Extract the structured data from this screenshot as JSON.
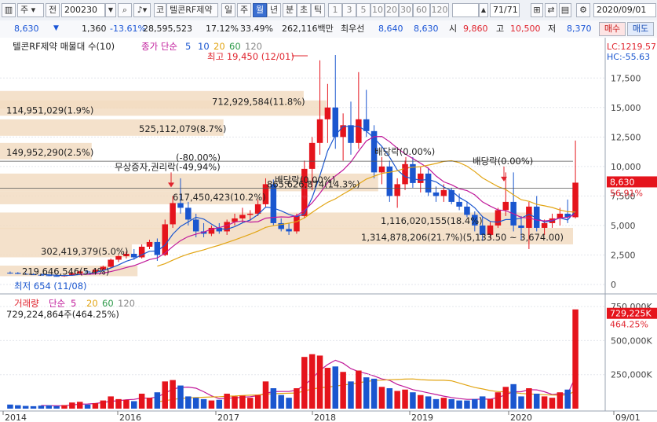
{
  "toolbar": {
    "market": "주",
    "basis": "전",
    "code": "200230",
    "stock_tag": "코",
    "stock_name": "텔콘RF제약",
    "periods": [
      "일",
      "주",
      "월",
      "년",
      "분",
      "초",
      "틱"
    ],
    "selected_period": "월",
    "intervals": [
      "1",
      "3",
      "5",
      "10",
      "20",
      "30",
      "60",
      "120"
    ],
    "page": "71",
    "page_total": "/71",
    "date": "2020/09/01"
  },
  "quote": {
    "price": "8,630",
    "change": "1,360",
    "change_pct": "-13.61%",
    "volume": "28,595,523",
    "vol_ratio_pct": "17.12%",
    "turnover_pct": "33.49%",
    "amount": "262,116백만",
    "bid_label": "최우선",
    "bid_ask": [
      "8,640",
      "8,630"
    ],
    "open_label": "시",
    "open": "9,860",
    "high_label": "고",
    "high": "10,500",
    "low_label": "저",
    "low": "8,370",
    "buy_label": "매수",
    "sell_label": "매도"
  },
  "price_panel": {
    "title": "텔콘RF제약 매물대 수(10)",
    "ma_label": "종가 단순",
    "ma_periods": [
      "5",
      "10",
      "20",
      "60",
      "120"
    ],
    "lc": "LC:1219.57",
    "hc": "HC:-55.63",
    "max_note": "최고 19,450 (12/01)",
    "min_note": "최저 654 (11/08)",
    "current_price": "8,630",
    "current_pct": "56.91%",
    "annotations": [
      {
        "label": "무상증자,권리락(-49,94%)",
        "sub": "(-80.00%)"
      },
      {
        "label": "배당락(0.00%)"
      },
      {
        "label": "배당락(0.00%)"
      },
      {
        "label": "배당락(0.00%)"
      }
    ],
    "profiles": [
      {
        "label": "114,951,029(1.9%)"
      },
      {
        "label": "149,952,290(2.5%)"
      },
      {
        "label": "712,929,584(11.8%)"
      },
      {
        "label": "525,112,079(8.7%)"
      },
      {
        "label": "865,626,874(14.3%)"
      },
      {
        "label": "617,450,423(10.2%)"
      },
      {
        "label": "1,116,020,155(18.4%)"
      },
      {
        "label": "1,314,878,206(21.7%)(5,133.50 ~ 3,674.00)"
      },
      {
        "label": "302,419,379(5.0%)"
      },
      {
        "label": "219,646,546(5.4%)"
      }
    ]
  },
  "volume_panel": {
    "title": "거래량",
    "ma_label": "단순",
    "ma_periods": [
      "5",
      "20",
      "60",
      "120"
    ],
    "current_text": "729,224,864주(464.25%)",
    "last_value": "729,225K",
    "last_pct": "464.25%"
  },
  "x_axis": [
    "2014",
    "2016",
    "2017",
    "2018",
    "2019",
    "2020",
    "09/01"
  ],
  "colors": {
    "up": "#e5141c",
    "down": "#1a56cf",
    "ma5": "#1a56cf",
    "ma10": "#c0199a",
    "ma20": "#e2a514",
    "profile": "#f2dcc2"
  },
  "chart_data": {
    "type": "candlestick",
    "price_ylim": [
      0,
      19450
    ],
    "price_yticks": [
      0,
      2500,
      5000,
      7500,
      10000,
      12500,
      15000,
      17500
    ],
    "volume_yticks": [
      250000,
      500000,
      750000
    ],
    "volume_unit": "K",
    "candles": [
      {
        "o": 1000,
        "h": 1100,
        "l": 900,
        "c": 980,
        "v": 30000
      },
      {
        "o": 980,
        "h": 1050,
        "l": 880,
        "c": 900,
        "v": 25000
      },
      {
        "o": 900,
        "h": 1000,
        "l": 820,
        "c": 860,
        "v": 20000
      },
      {
        "o": 860,
        "h": 950,
        "l": 800,
        "c": 820,
        "v": 18000
      },
      {
        "o": 820,
        "h": 900,
        "l": 760,
        "c": 780,
        "v": 22000
      },
      {
        "o": 780,
        "h": 880,
        "l": 700,
        "c": 720,
        "v": 24000
      },
      {
        "o": 720,
        "h": 820,
        "l": 680,
        "c": 700,
        "v": 19000
      },
      {
        "o": 700,
        "h": 800,
        "l": 654,
        "c": 760,
        "v": 26000
      },
      {
        "o": 760,
        "h": 1000,
        "l": 740,
        "c": 950,
        "v": 45000
      },
      {
        "o": 950,
        "h": 1150,
        "l": 900,
        "c": 1100,
        "v": 50000
      },
      {
        "o": 1100,
        "h": 1200,
        "l": 1000,
        "c": 1050,
        "v": 30000
      },
      {
        "o": 1050,
        "h": 1300,
        "l": 1000,
        "c": 1250,
        "v": 40000
      },
      {
        "o": 1250,
        "h": 1600,
        "l": 1200,
        "c": 1500,
        "v": 60000
      },
      {
        "o": 1500,
        "h": 2200,
        "l": 1400,
        "c": 2100,
        "v": 90000
      },
      {
        "o": 2100,
        "h": 2500,
        "l": 1900,
        "c": 2400,
        "v": 70000
      },
      {
        "o": 2400,
        "h": 2800,
        "l": 2200,
        "c": 2600,
        "v": 65000
      },
      {
        "o": 2600,
        "h": 3000,
        "l": 2100,
        "c": 2300,
        "v": 55000
      },
      {
        "o": 2300,
        "h": 3400,
        "l": 2200,
        "c": 3200,
        "v": 110000
      },
      {
        "o": 3200,
        "h": 3800,
        "l": 3000,
        "c": 3600,
        "v": 80000
      },
      {
        "o": 3600,
        "h": 3900,
        "l": 2000,
        "c": 2500,
        "v": 120000
      },
      {
        "o": 2500,
        "h": 5500,
        "l": 2400,
        "c": 5100,
        "v": 200000
      },
      {
        "o": 5100,
        "h": 7500,
        "l": 4800,
        "c": 6900,
        "v": 210000
      },
      {
        "o": 6900,
        "h": 9000,
        "l": 6000,
        "c": 6500,
        "v": 170000
      },
      {
        "o": 6500,
        "h": 7000,
        "l": 5000,
        "c": 5500,
        "v": 90000
      },
      {
        "o": 5500,
        "h": 6000,
        "l": 4000,
        "c": 4500,
        "v": 80000
      },
      {
        "o": 4500,
        "h": 5200,
        "l": 4000,
        "c": 4300,
        "v": 70000
      },
      {
        "o": 4300,
        "h": 5000,
        "l": 4100,
        "c": 4800,
        "v": 60000
      },
      {
        "o": 4800,
        "h": 5200,
        "l": 4300,
        "c": 4500,
        "v": 65000
      },
      {
        "o": 4500,
        "h": 5500,
        "l": 4200,
        "c": 5300,
        "v": 110000
      },
      {
        "o": 5300,
        "h": 6000,
        "l": 5000,
        "c": 5600,
        "v": 90000
      },
      {
        "o": 5600,
        "h": 6500,
        "l": 5200,
        "c": 5900,
        "v": 95000
      },
      {
        "o": 5900,
        "h": 6300,
        "l": 5400,
        "c": 6000,
        "v": 80000
      },
      {
        "o": 6000,
        "h": 7200,
        "l": 5800,
        "c": 6800,
        "v": 100000
      },
      {
        "o": 6800,
        "h": 9000,
        "l": 6500,
        "c": 8500,
        "v": 200000
      },
      {
        "o": 8500,
        "h": 8900,
        "l": 5000,
        "c": 5200,
        "v": 150000
      },
      {
        "o": 5200,
        "h": 5600,
        "l": 4500,
        "c": 4700,
        "v": 100000
      },
      {
        "o": 4700,
        "h": 5200,
        "l": 4200,
        "c": 4500,
        "v": 80000
      },
      {
        "o": 4500,
        "h": 6000,
        "l": 4300,
        "c": 5800,
        "v": 150000
      },
      {
        "o": 5800,
        "h": 10500,
        "l": 5600,
        "c": 9800,
        "v": 380000
      },
      {
        "o": 9800,
        "h": 12500,
        "l": 8000,
        "c": 12000,
        "v": 400000
      },
      {
        "o": 12000,
        "h": 19000,
        "l": 11000,
        "c": 14000,
        "v": 390000
      },
      {
        "o": 14000,
        "h": 17000,
        "l": 12000,
        "c": 15000,
        "v": 300000
      },
      {
        "o": 15000,
        "h": 19450,
        "l": 11500,
        "c": 12500,
        "v": 310000
      },
      {
        "o": 12500,
        "h": 14500,
        "l": 10500,
        "c": 13500,
        "v": 270000
      },
      {
        "o": 13500,
        "h": 15500,
        "l": 11000,
        "c": 12000,
        "v": 200000
      },
      {
        "o": 12000,
        "h": 18000,
        "l": 11500,
        "c": 14000,
        "v": 280000
      },
      {
        "o": 14000,
        "h": 16500,
        "l": 12500,
        "c": 13000,
        "v": 230000
      },
      {
        "o": 13000,
        "h": 13500,
        "l": 9000,
        "c": 9500,
        "v": 220000
      },
      {
        "o": 9500,
        "h": 10800,
        "l": 8500,
        "c": 10000,
        "v": 160000
      },
      {
        "o": 10000,
        "h": 10500,
        "l": 7000,
        "c": 7500,
        "v": 150000
      },
      {
        "o": 7500,
        "h": 9000,
        "l": 6500,
        "c": 8500,
        "v": 130000
      },
      {
        "o": 8500,
        "h": 10500,
        "l": 8000,
        "c": 10200,
        "v": 140000
      },
      {
        "o": 10200,
        "h": 10800,
        "l": 8200,
        "c": 8600,
        "v": 120000
      },
      {
        "o": 8600,
        "h": 10000,
        "l": 7800,
        "c": 9400,
        "v": 100000
      },
      {
        "o": 9400,
        "h": 9900,
        "l": 7500,
        "c": 7800,
        "v": 90000
      },
      {
        "o": 7800,
        "h": 8300,
        "l": 7000,
        "c": 7500,
        "v": 70000
      },
      {
        "o": 7500,
        "h": 8500,
        "l": 7000,
        "c": 8000,
        "v": 80000
      },
      {
        "o": 8000,
        "h": 8200,
        "l": 6800,
        "c": 7000,
        "v": 70000
      },
      {
        "o": 7000,
        "h": 7700,
        "l": 6300,
        "c": 6600,
        "v": 60000
      },
      {
        "o": 6600,
        "h": 7000,
        "l": 5700,
        "c": 5900,
        "v": 60000
      },
      {
        "o": 5900,
        "h": 6200,
        "l": 4500,
        "c": 5000,
        "v": 70000
      },
      {
        "o": 5000,
        "h": 5700,
        "l": 3700,
        "c": 4200,
        "v": 90000
      },
      {
        "o": 4200,
        "h": 5300,
        "l": 3900,
        "c": 5000,
        "v": 70000
      },
      {
        "o": 5000,
        "h": 6500,
        "l": 4800,
        "c": 6300,
        "v": 120000
      },
      {
        "o": 6300,
        "h": 9500,
        "l": 5800,
        "c": 7000,
        "v": 160000
      },
      {
        "o": 7000,
        "h": 9500,
        "l": 4500,
        "c": 5000,
        "v": 180000
      },
      {
        "o": 5000,
        "h": 5800,
        "l": 3800,
        "c": 4800,
        "v": 90000
      },
      {
        "o": 4800,
        "h": 7000,
        "l": 3000,
        "c": 6600,
        "v": 150000
      },
      {
        "o": 6600,
        "h": 7500,
        "l": 4500,
        "c": 4800,
        "v": 110000
      },
      {
        "o": 4800,
        "h": 5500,
        "l": 4200,
        "c": 5200,
        "v": 90000
      },
      {
        "o": 5200,
        "h": 6000,
        "l": 4800,
        "c": 5600,
        "v": 80000
      },
      {
        "o": 5600,
        "h": 6500,
        "l": 5000,
        "c": 6000,
        "v": 120000
      },
      {
        "o": 6000,
        "h": 7200,
        "l": 5200,
        "c": 5700,
        "v": 140000
      },
      {
        "o": 5700,
        "h": 12200,
        "l": 5600,
        "c": 8630,
        "v": 729225
      }
    ]
  }
}
